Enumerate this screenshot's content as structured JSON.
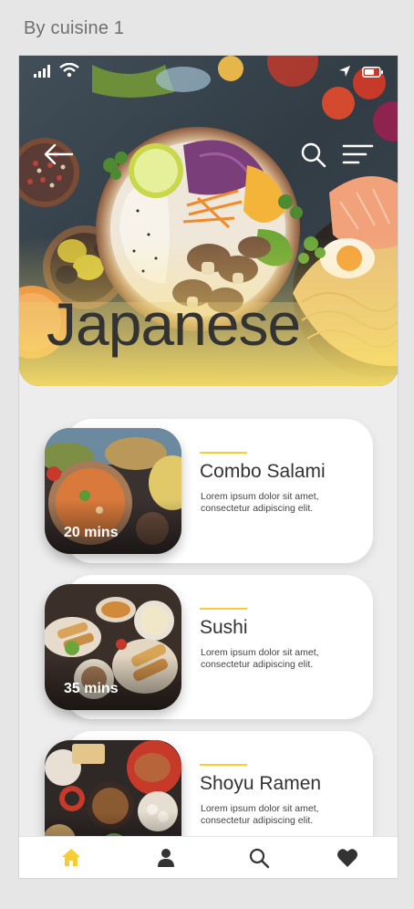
{
  "artboard": {
    "title": "By cuisine 1"
  },
  "hero": {
    "title": "Japanese",
    "back_icon": "arrow-left-icon",
    "search_icon": "search-icon",
    "filter_icon": "filter-lines-icon"
  },
  "status_bar": {
    "signal_icon": "cellular-signal-icon",
    "wifi_icon": "wifi-icon",
    "location_icon": "location-arrow-icon",
    "battery_icon": "battery-icon"
  },
  "dishes": [
    {
      "title": "Combo Salami",
      "time": "20 mins",
      "description": "Lorem ipsum dolor sit amet, consectetur adipiscing elit."
    },
    {
      "title": "Sushi",
      "time": "35 mins",
      "description": "Lorem ipsum dolor sit amet, consectetur adipiscing elit."
    },
    {
      "title": "Shoyu Ramen",
      "time": "",
      "description": "Lorem ipsum dolor sit amet, consectetur adipiscing elit."
    }
  ],
  "tabbar": {
    "items": [
      {
        "icon": "home-icon",
        "active": true
      },
      {
        "icon": "profile-icon",
        "active": false
      },
      {
        "icon": "search-icon",
        "active": false
      },
      {
        "icon": "heart-icon",
        "active": false
      }
    ]
  },
  "colors": {
    "accent": "#f6cd35",
    "active_tab": "#f6cd35",
    "inactive_tab": "#333333",
    "title_text": "#333333"
  }
}
